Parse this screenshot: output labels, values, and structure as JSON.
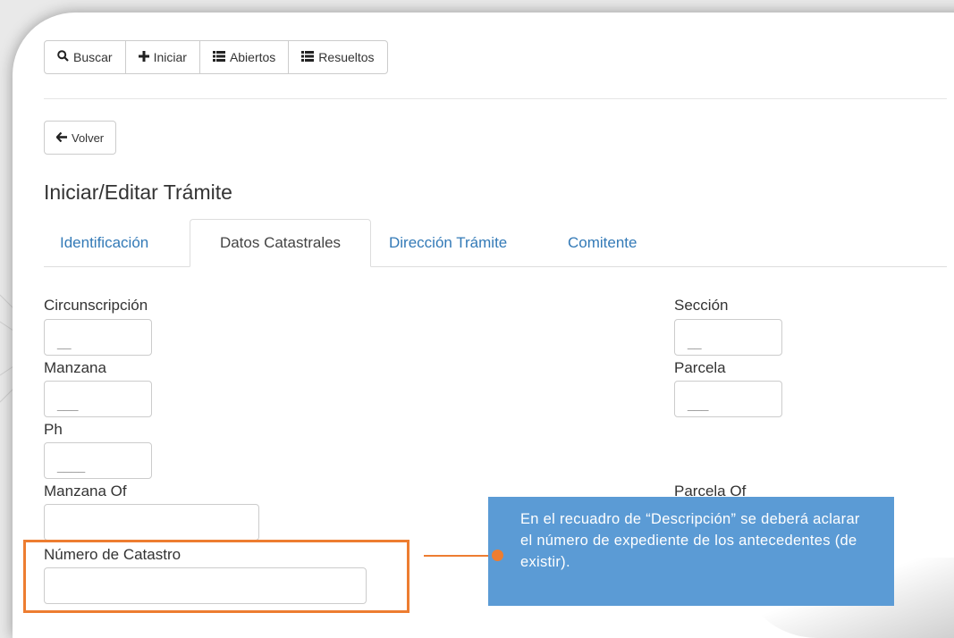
{
  "toolbar": {
    "buscar": {
      "icon": "search-icon",
      "label": "Buscar"
    },
    "iniciar": {
      "icon": "plus-icon",
      "label": "Iniciar"
    },
    "abiertos": {
      "icon": "list-icon",
      "label": "Abiertos"
    },
    "resueltos": {
      "icon": "list-icon",
      "label": "Resueltos"
    }
  },
  "back_button": {
    "icon": "arrow-left-icon",
    "label": "Volver"
  },
  "page_title": "Iniciar/Editar Trámite",
  "tabs": [
    {
      "label": "Identificación",
      "active": false
    },
    {
      "label": "Datos Catastrales",
      "active": true
    },
    {
      "label": "Dirección Trámite",
      "active": false
    },
    {
      "label": "Comitente",
      "active": false
    }
  ],
  "form": {
    "circunscripcion": {
      "label": "Circunscripción",
      "placeholder": "__"
    },
    "seccion": {
      "label": "Sección",
      "placeholder": "__"
    },
    "manzana": {
      "label": "Manzana",
      "placeholder": "___"
    },
    "parcela": {
      "label": "Parcela",
      "placeholder": "___"
    },
    "ph": {
      "label": "Ph",
      "placeholder": "____"
    },
    "manzana_of": {
      "label": "Manzana Of",
      "placeholder": ""
    },
    "parcela_of": {
      "label": "Parcela Of",
      "placeholder": ""
    },
    "numero_catastro": {
      "label": "Número de Catastro",
      "placeholder": ""
    }
  },
  "callout": {
    "text": "En el recuadro de “Descripción” se deberá aclarar el número de expediente de los antecedentes (de existir)."
  },
  "colors": {
    "link": "#337ab7",
    "highlight": "#ed7d31",
    "callout_bg": "#5b9bd5"
  }
}
